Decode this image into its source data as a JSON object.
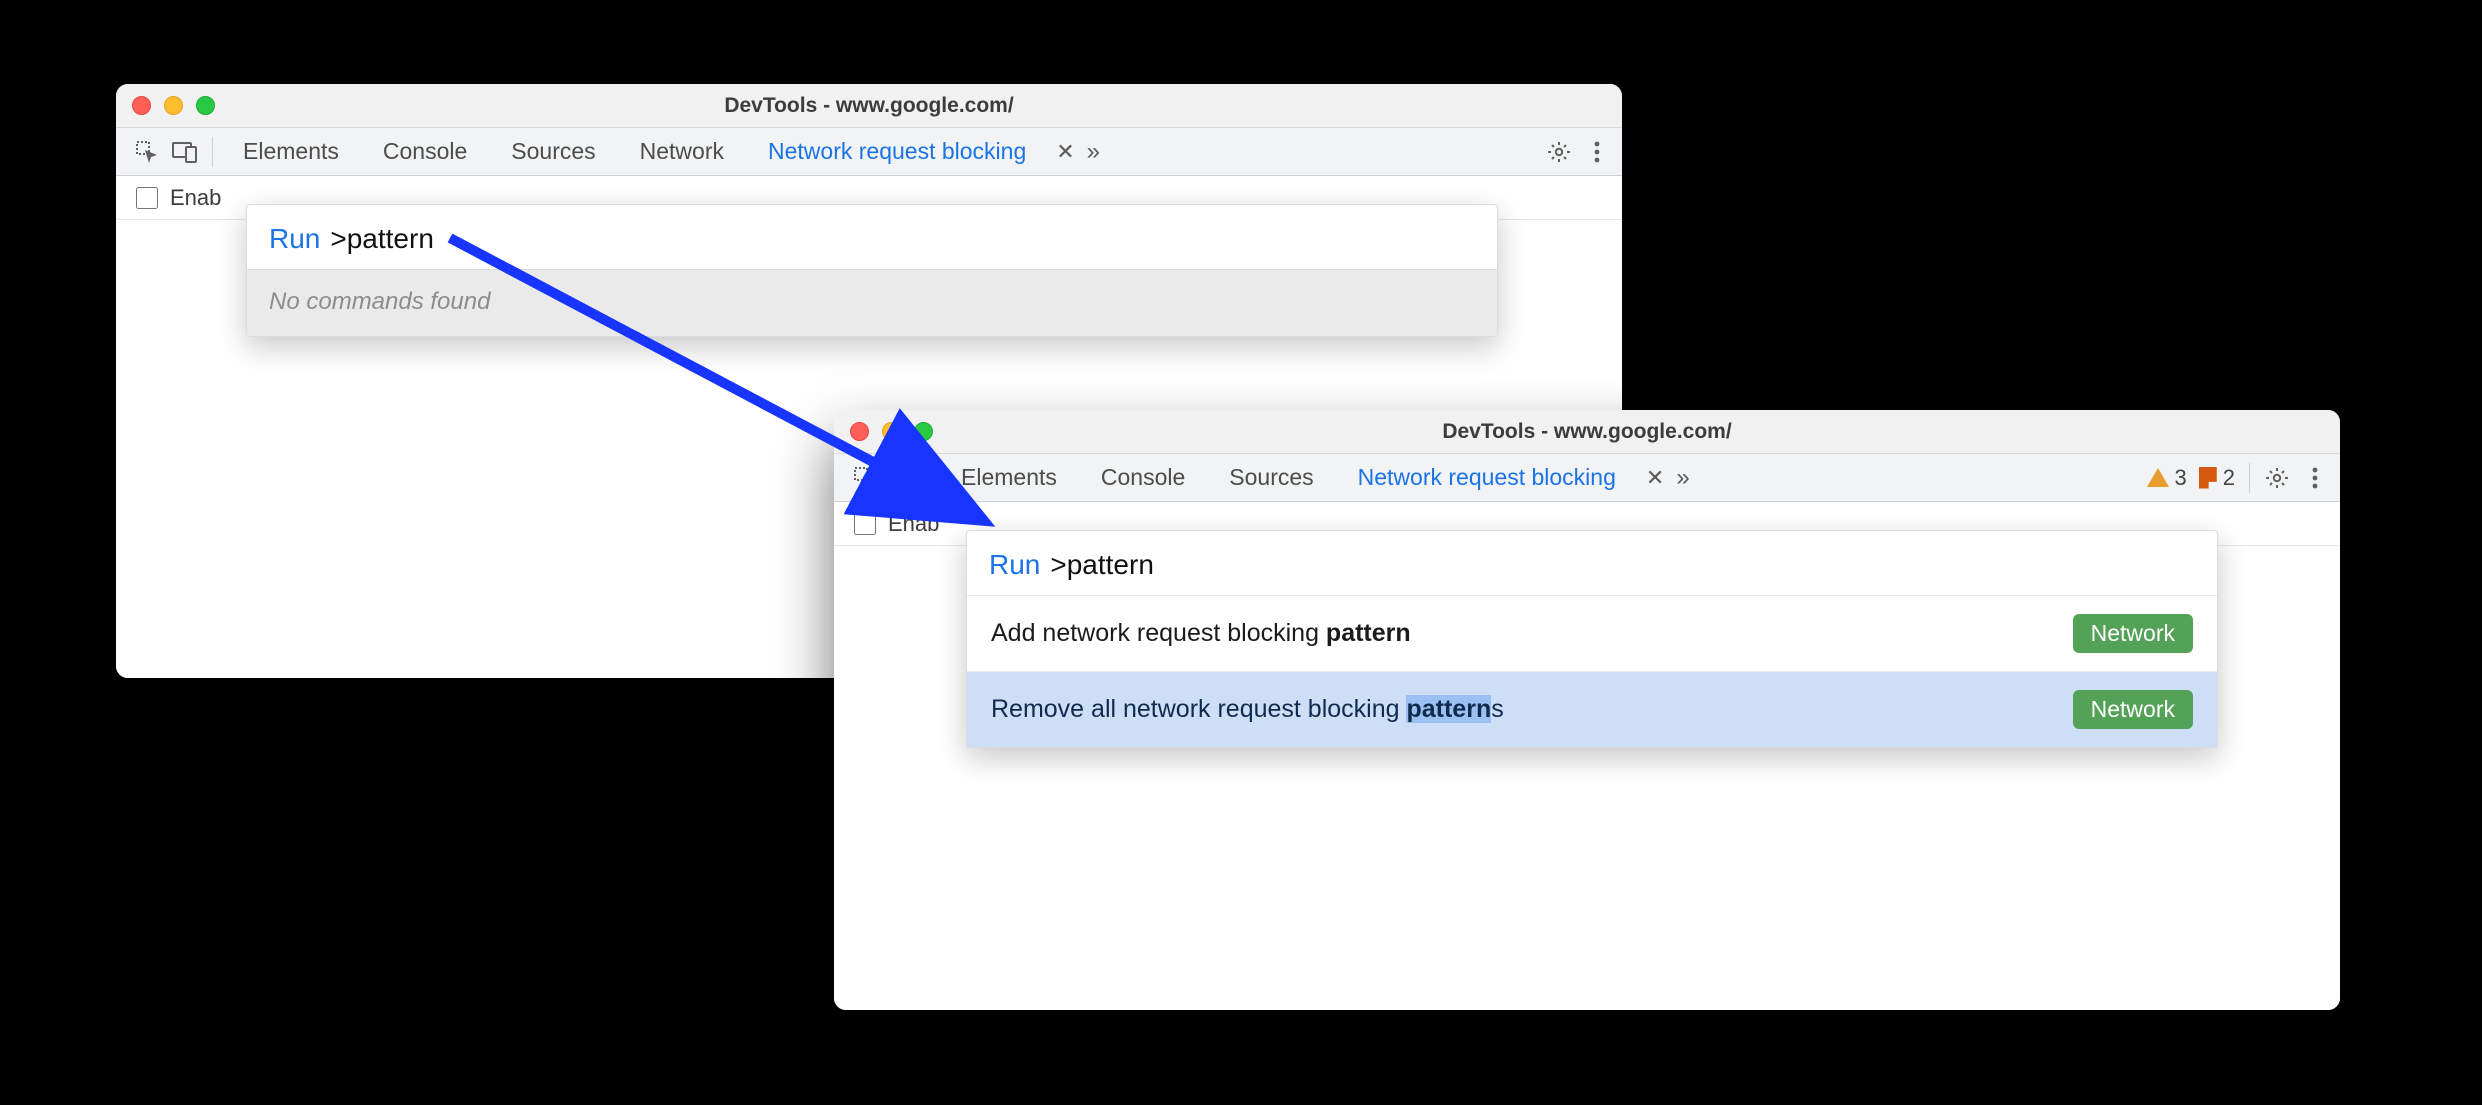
{
  "window1": {
    "title": "DevTools - www.google.com/",
    "tabs": {
      "elements": "Elements",
      "console": "Console",
      "sources": "Sources",
      "network": "Network",
      "blocking": "Network request blocking"
    },
    "enable_label": "Enab",
    "palette": {
      "run": "Run",
      "query": ">pattern",
      "empty": "No commands found"
    }
  },
  "window2": {
    "title": "DevTools - www.google.com/",
    "tabs": {
      "elements": "Elements",
      "console": "Console",
      "sources": "Sources",
      "blocking": "Network request blocking"
    },
    "warnings": "3",
    "issues": "2",
    "enable_label": "Enab",
    "palette": {
      "run": "Run",
      "query": ">pattern",
      "items": [
        {
          "before": "Add network request blocking ",
          "match": "pattern",
          "after": "",
          "category": "Network",
          "selected": false
        },
        {
          "before": "Remove all network request blocking ",
          "match": "pattern",
          "after": "s",
          "category": "Network",
          "selected": true
        }
      ]
    }
  }
}
